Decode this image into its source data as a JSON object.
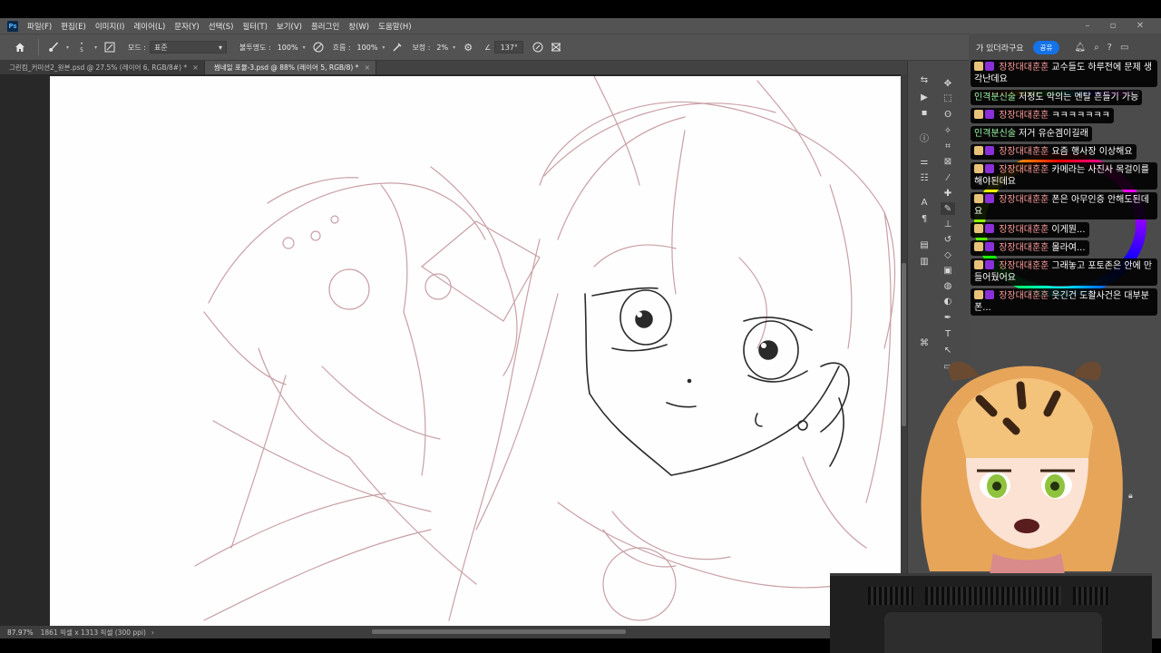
{
  "menubar": {
    "logo": "Ps",
    "items": [
      "파일(F)",
      "편집(E)",
      "이미지(I)",
      "레이어(L)",
      "문자(Y)",
      "선택(S)",
      "필터(T)",
      "보기(V)",
      "플러그인",
      "창(W)",
      "도움말(H)"
    ]
  },
  "options": {
    "brush_size": "5",
    "mode_label": "모드 :",
    "mode_value": "표준",
    "opacity_label": "불투명도 :",
    "opacity_value": "100%",
    "flow_label": "흐름 :",
    "flow_value": "100%",
    "smoothing_label": "보정 :",
    "smoothing_value": "2%",
    "angle_label": "∠",
    "angle_value": "137°"
  },
  "tabs": [
    {
      "label": "그린킴_커미션2_원본.psd @ 27.5% (레이어 6, RGB/8#) *"
    },
    {
      "label": "썸네일 포뮬-3.psd @ 88% (레이어 5, RGB/8) *"
    }
  ],
  "status": {
    "zoom": "87.97%",
    "info": "1861 픽셀 x 1313 픽셀 (300 ppi)"
  },
  "panel": {
    "header_text": "가 있더라구요",
    "share_label": "공유"
  },
  "chat": [
    {
      "user": "장장대대훈훈",
      "text": "교수들도 하루전에 문제 생각난데요",
      "badges": true
    },
    {
      "user": "인격분신술",
      "text": "저정도 악의는 멘탈 흔들기 가능",
      "badges": false
    },
    {
      "user": "장장대대훈훈",
      "text": "ㅋㅋㅋㅋㅋㅋㅋ",
      "badges": true
    },
    {
      "user": "인격분신술",
      "text": "저거 유순겜이길래",
      "badges": false
    },
    {
      "user": "장장대대훈훈",
      "text": "요즘 행사장 이상해요",
      "badges": true
    },
    {
      "user": "장장대대훈훈",
      "text": "카메라는 사진사 목걸이를 해야된데요",
      "badges": true
    },
    {
      "user": "장장대대훈훈",
      "text": "폰은 아무인증 안해도된데요",
      "badges": true
    },
    {
      "user": "장장대대훈훈",
      "text": "이게뭔...",
      "badges": true
    },
    {
      "user": "장장대대훈훈",
      "text": "몰라여...",
      "badges": true
    },
    {
      "user": "장장대대훈훈",
      "text": "그래놓고 포토존은 안에 만들어뒀어요",
      "badges": true
    },
    {
      "user": "장장대대훈훈",
      "text": "웃긴건 도촬사건은 대부분 폰...",
      "badges": true
    }
  ],
  "colors": {
    "ps_bg": "#535353",
    "canvas_bg": "#fefefe",
    "sketch_line": "#c9a0a6",
    "ink_line": "#2a2a2a",
    "accent": "#1473e6"
  }
}
